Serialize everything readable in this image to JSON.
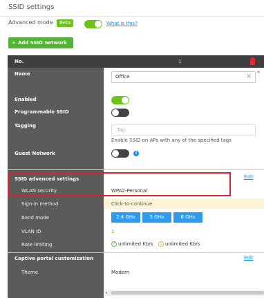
{
  "page": {
    "title": "SSID settings",
    "advanced_mode_label": "Advanced mode",
    "beta_badge": "Beta",
    "advanced_mode_on": true,
    "what_is_this": "What is this?",
    "add_button": "Add SSID network",
    "add_button_icon": "+"
  },
  "table": {
    "header_label": "No.",
    "header_number": "1",
    "rows": {
      "name": {
        "label": "Name",
        "value": "Office",
        "clear_icon": "×",
        "required": "*"
      },
      "enabled": {
        "label": "Enabled",
        "on": true
      },
      "programmable": {
        "label": "Programmable SSID",
        "on": false
      },
      "tagging": {
        "label": "Tagging",
        "placeholder": "Tag",
        "help": "Enable SSID on APs with any of the specified tags"
      },
      "guest": {
        "label": "Guest Network",
        "on": false,
        "info_icon": "i"
      }
    },
    "advanced": {
      "section_label": "SSID advanced settings",
      "edit": "Edit",
      "wlan_security": {
        "label": "WLAN security",
        "value": "WPA2-Personal"
      },
      "signin": {
        "label": "Sign-in method",
        "value": "Click-to-continue"
      },
      "band_mode": {
        "label": "Band mode",
        "options": [
          "2.4 GHz",
          "5 GHz",
          "6 GHz"
        ]
      },
      "vlan": {
        "label": "VLAN ID",
        "value": "1"
      },
      "rate": {
        "label": "Rate limiting",
        "up": "unlimited Kb/s",
        "down": "unlimited Kb/s"
      }
    },
    "captive": {
      "section_label": "Captive portal customization",
      "edit": "Edit",
      "theme": {
        "label": "Theme",
        "value": "Modern"
      }
    }
  },
  "colors": {
    "accent_green": "#6cc417",
    "link_blue": "#1890e6",
    "highlight_red": "#d9232e",
    "panel_dark": "#5b5b5b"
  }
}
